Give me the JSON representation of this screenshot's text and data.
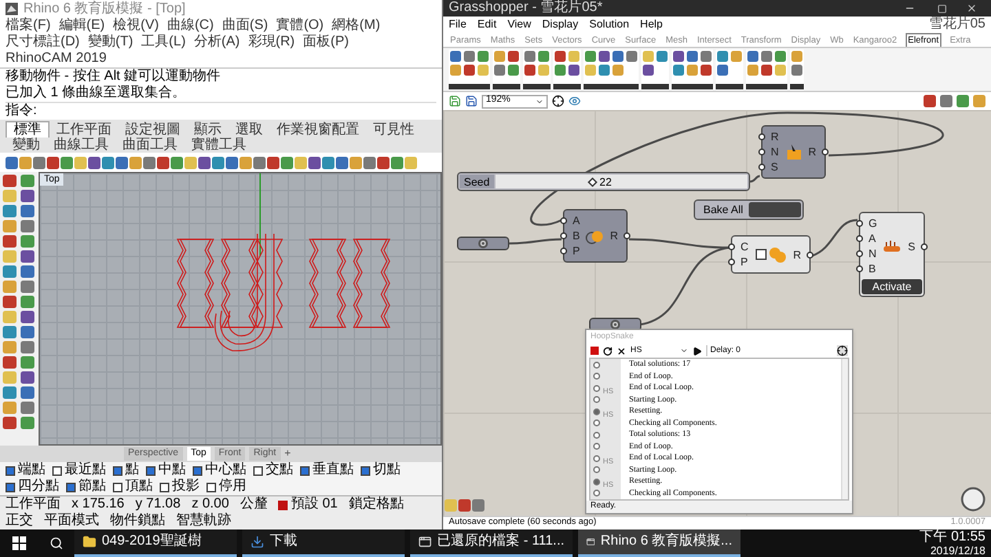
{
  "rhino": {
    "title": "Rhino 6 教育版模擬 - [Top]",
    "menu": [
      "檔案(F)",
      "編輯(E)",
      "檢視(V)",
      "曲線(C)",
      "曲面(S)",
      "實體(O)",
      "網格(M)",
      "尺寸標註(D)",
      "變動(T)",
      "工具(L)",
      "分析(A)",
      "彩現(R)",
      "面板(P)",
      "RhinoCAM 2019"
    ],
    "command_history": [
      "移動物件 - 按住 Alt 鍵可以運動物件",
      "已加入 1 條曲線至選取集合。"
    ],
    "command_prompt": "指令:",
    "tabs": [
      {
        "label": "標準",
        "selected": true
      },
      {
        "label": "工作平面",
        "selected": false
      },
      {
        "label": "設定視圖",
        "selected": false
      },
      {
        "label": "顯示",
        "selected": false
      },
      {
        "label": "選取",
        "selected": false
      },
      {
        "label": "作業視窗配置",
        "selected": false
      },
      {
        "label": "可見性",
        "selected": false
      },
      {
        "label": "變動",
        "selected": false
      },
      {
        "label": "曲線工具",
        "selected": false
      },
      {
        "label": "曲面工具",
        "selected": false
      },
      {
        "label": "實體工具",
        "selected": false
      }
    ],
    "viewport": {
      "label": "Top"
    },
    "viewport_tabs": [
      {
        "label": "Perspective",
        "selected": false
      },
      {
        "label": "Top",
        "selected": true
      },
      {
        "label": "Front",
        "selected": false
      },
      {
        "label": "Right",
        "selected": false
      }
    ],
    "add_viewport": "+",
    "osnaps": [
      {
        "label": "端點",
        "checked": true
      },
      {
        "label": "最近點",
        "checked": false
      },
      {
        "label": "點",
        "checked": true
      },
      {
        "label": "中點",
        "checked": true
      },
      {
        "label": "中心點",
        "checked": true
      },
      {
        "label": "交點",
        "checked": false
      },
      {
        "label": "垂直點",
        "checked": true
      },
      {
        "label": "切點",
        "checked": true
      },
      {
        "label": "四分點",
        "checked": true
      },
      {
        "label": "節點",
        "checked": true
      },
      {
        "label": "頂點",
        "checked": false
      },
      {
        "label": "投影",
        "checked": false
      },
      {
        "label": "停用",
        "checked": false
      }
    ],
    "status": {
      "cplane": "工作平面",
      "x": "x 175.16",
      "y": "y 71.08",
      "z": "z 0.00",
      "units": "公釐",
      "layer": "預設 01",
      "toggles": [
        "鎖定格點",
        "正交",
        "平面模式",
        "物件鎖點",
        "智慧軌跡"
      ]
    }
  },
  "grasshopper": {
    "title": "Grasshopper - 雪花片05*",
    "menu": [
      "File",
      "Edit",
      "View",
      "Display",
      "Solution",
      "Help"
    ],
    "document": "雪花片05",
    "tabs": [
      {
        "label": "Params",
        "selected": false
      },
      {
        "label": "Maths",
        "selected": false
      },
      {
        "label": "Sets",
        "selected": false
      },
      {
        "label": "Vectors",
        "selected": false
      },
      {
        "label": "Curve",
        "selected": false
      },
      {
        "label": "Surface",
        "selected": false
      },
      {
        "label": "Mesh",
        "selected": false
      },
      {
        "label": "Intersect",
        "selected": false
      },
      {
        "label": "Transform",
        "selected": false
      },
      {
        "label": "Display",
        "selected": false
      },
      {
        "label": "Wb",
        "selected": false
      },
      {
        "label": "Kangaroo2",
        "selected": false
      },
      {
        "label": "Elefront",
        "selected": true
      },
      {
        "label": "Extra",
        "selected": false
      }
    ],
    "zoom": "192%",
    "slider": {
      "label": "Seed",
      "value": "22",
      "level": 0.37
    },
    "bake_button": "Bake All",
    "components": [
      {
        "kind": "dark",
        "inputs": [
          "R",
          "N",
          "S"
        ],
        "outputs": [
          "R"
        ]
      },
      {
        "kind": "dark",
        "inputs": [
          "A",
          "B",
          "P"
        ],
        "outputs": [
          "R"
        ]
      },
      {
        "kind": "light",
        "inputs": [
          "C",
          "P"
        ],
        "outputs": [
          "R"
        ]
      },
      {
        "kind": "light",
        "inputs": [
          "G",
          "A",
          "N",
          "B"
        ],
        "outputs": [
          "S"
        ],
        "button": "Activate"
      }
    ],
    "hoopsnake": {
      "title": "HoopSnake",
      "target": "HS",
      "delay": "Delay: 0",
      "status": "Ready.",
      "log": [
        {
          "kind": "info",
          "text": "Total solutions: 17"
        },
        {
          "kind": "info",
          "text": "End of Loop."
        },
        {
          "kind": "info",
          "tag": "HS",
          "text": "End of Local Loop."
        },
        {
          "kind": "info",
          "text": "Starting Loop."
        },
        {
          "kind": "reset",
          "tag": "HS",
          "text": "Resetting."
        },
        {
          "kind": "info",
          "text": "Checking all Components."
        },
        {
          "kind": "info",
          "text": "Total solutions: 13"
        },
        {
          "kind": "info",
          "text": "End of Loop."
        },
        {
          "kind": "info",
          "tag": "HS",
          "text": "End of Local Loop."
        },
        {
          "kind": "info",
          "text": "Starting Loop."
        },
        {
          "kind": "reset",
          "tag": "HS",
          "text": "Resetting."
        },
        {
          "kind": "info",
          "text": "Checking all Components."
        }
      ]
    },
    "status": "Autosave complete (60 seconds ago)",
    "version": "1.0.0007"
  },
  "taskbar": {
    "items": [
      {
        "kind": "folder",
        "label": "049-2019聖誕樹",
        "selected": false
      },
      {
        "kind": "download",
        "label": "下載",
        "selected": false
      },
      {
        "kind": "app",
        "label": "已還原的檔案 - 111...",
        "selected": false
      },
      {
        "kind": "app",
        "label": "Rhino 6 教育版模擬...",
        "selected": true
      }
    ],
    "time": "下午 01:55",
    "date": "2019/12/18"
  }
}
